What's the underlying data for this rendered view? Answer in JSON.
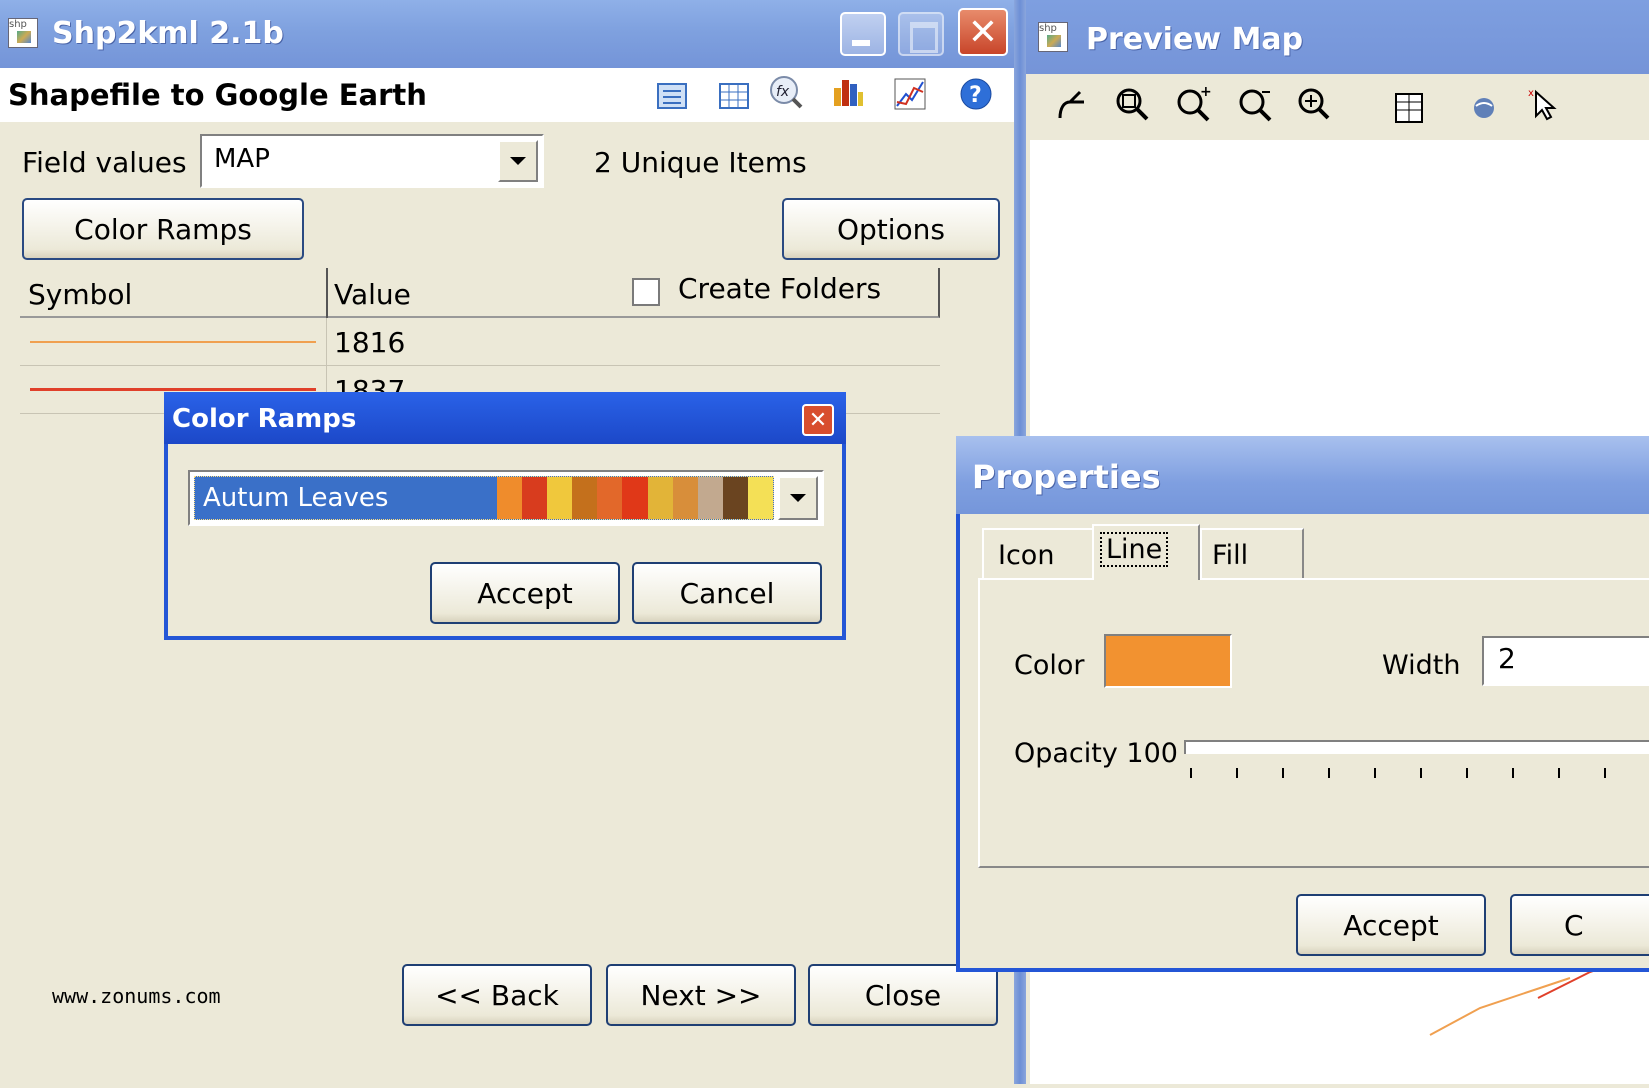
{
  "main_window": {
    "title": "Shp2kml 2.1b",
    "subtitle": "Shapefile to Google Earth",
    "field_values_label": "Field values",
    "field_values_selected": "MAP",
    "unique_items": "2 Unique Items",
    "color_ramps_button": "Color Ramps",
    "options_button": "Options",
    "table": {
      "headers": [
        "Symbol",
        "Value"
      ],
      "create_folders_label": "Create Folders",
      "create_folders_checked": false,
      "rows": [
        {
          "value": "1816",
          "line_color": "#f0a050"
        },
        {
          "value": "1837",
          "line_color": "#e0402a"
        }
      ]
    },
    "footer_text": "www.zonums.com",
    "back_button": "<< Back",
    "next_button": "Next >>",
    "close_button": "Close"
  },
  "color_ramps_dialog": {
    "title": "Color Ramps",
    "selected_ramp": "Autum Leaves",
    "swatches": [
      "#ef8c2c",
      "#d83c1e",
      "#f0c83c",
      "#c4701c",
      "#e2682a",
      "#e03818",
      "#e2b438",
      "#d88e3a",
      "#c2a98f",
      "#6a4420",
      "#f4e056"
    ],
    "accept_button": "Accept",
    "cancel_button": "Cancel"
  },
  "preview_window": {
    "title": "Preview Map"
  },
  "properties_dialog": {
    "title": "Properties",
    "tabs": [
      "Icon",
      "Line",
      "Fill"
    ],
    "active_tab": "Line",
    "color_label": "Color",
    "color_value": "#f29230",
    "width_label": "Width",
    "width_value": "2",
    "opacity_label": "Opacity 100",
    "opacity_value": 100,
    "accept_button": "Accept",
    "cancel_button_partial": "C"
  }
}
